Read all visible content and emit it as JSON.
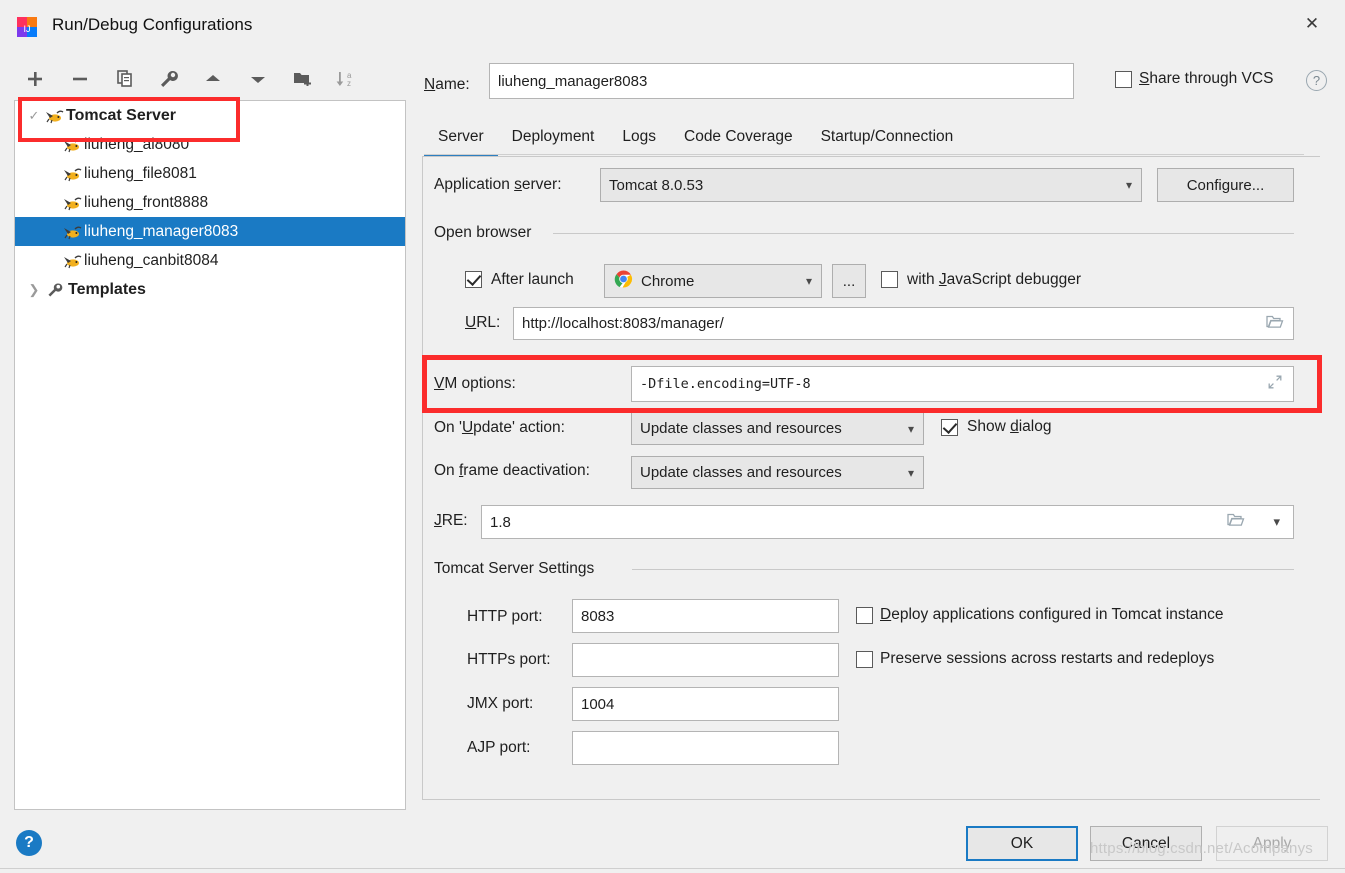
{
  "window": {
    "title": "Run/Debug Configurations",
    "app_icon": "intellij-idea-icon",
    "close_icon": "close-icon"
  },
  "toolbar": {
    "buttons": [
      {
        "name": "add-configuration",
        "icon": "plus-icon",
        "label": "+"
      },
      {
        "name": "remove-configuration",
        "icon": "minus-icon",
        "label": "−"
      },
      {
        "name": "copy-configuration",
        "icon": "copy-icon",
        "label": "copy"
      },
      {
        "name": "edit-templates",
        "icon": "wrench-icon",
        "label": "wrench"
      },
      {
        "name": "move-up",
        "icon": "arrow-up-icon",
        "label": "▲"
      },
      {
        "name": "move-down",
        "icon": "arrow-down-icon",
        "label": "▼"
      },
      {
        "name": "create-folder",
        "icon": "new-folder-icon",
        "label": "folder+"
      },
      {
        "name": "sort-alphabetically",
        "icon": "sort-az-icon",
        "label": "sort a-z"
      }
    ]
  },
  "tree": {
    "items": [
      {
        "label": "Tomcat Server",
        "level": 0,
        "bold": true,
        "selected": false,
        "twisty": "expanded",
        "icon": "tomcat-icon",
        "highlighted": true
      },
      {
        "label": "liuheng_ai8080",
        "level": 1,
        "bold": false,
        "selected": false,
        "twisty": "",
        "icon": "tomcat-icon",
        "highlighted": false
      },
      {
        "label": "liuheng_file8081",
        "level": 1,
        "bold": false,
        "selected": false,
        "twisty": "",
        "icon": "tomcat-icon",
        "highlighted": false
      },
      {
        "label": "liuheng_front8888",
        "level": 1,
        "bold": false,
        "selected": false,
        "twisty": "",
        "icon": "tomcat-icon",
        "highlighted": false
      },
      {
        "label": "liuheng_manager8083",
        "level": 1,
        "bold": false,
        "selected": true,
        "twisty": "",
        "icon": "tomcat-icon",
        "highlighted": false
      },
      {
        "label": "liuheng_canbit8084",
        "level": 1,
        "bold": false,
        "selected": false,
        "twisty": "",
        "icon": "tomcat-icon",
        "highlighted": false
      },
      {
        "label": "Templates",
        "level": 0,
        "bold": true,
        "selected": false,
        "twisty": "collapsed",
        "icon": "wrench-icon",
        "highlighted": false
      }
    ]
  },
  "header": {
    "name_label": "Name:",
    "name_value": "liuheng_manager8083",
    "share_label": "Share through VCS",
    "share_checked": false,
    "help_icon": "help-circle-icon"
  },
  "tabs": [
    {
      "label": "Server",
      "active": true
    },
    {
      "label": "Deployment",
      "active": false
    },
    {
      "label": "Logs",
      "active": false
    },
    {
      "label": "Code Coverage",
      "active": false
    },
    {
      "label": "Startup/Connection",
      "active": false
    }
  ],
  "server_tab": {
    "application_server_label": "Application server:",
    "application_server_value": "Tomcat 8.0.53",
    "configure_button": "Configure...",
    "open_browser_group": "Open browser",
    "after_launch_label": "After launch",
    "after_launch_checked": true,
    "browser_value": "Chrome",
    "browser_icon": "chrome-icon",
    "ellipsis_button": "...",
    "js_debugger_label": "with JavaScript debugger",
    "js_debugger_checked": false,
    "url_label": "URL:",
    "url_value": "http://localhost:8083/manager/",
    "url_browse_icon": "folder-open-icon",
    "vm_options_label": "VM options:",
    "vm_options_value": "-Dfile.encoding=UTF-8",
    "vm_options_expand_icon": "expand-arrows-icon",
    "vm_options_highlighted": true,
    "on_update_label": "On 'Update' action:",
    "on_update_value": "Update classes and resources",
    "show_dialog_label": "Show dialog",
    "show_dialog_checked": true,
    "on_frame_deactivation_label": "On frame deactivation:",
    "on_frame_deactivation_value": "Update classes and resources",
    "jre_label": "JRE:",
    "jre_value": "1.8",
    "jre_browse_icon": "folder-open-icon",
    "jre_caret_icon": "chevron-down-icon",
    "tomcat_settings_group": "Tomcat Server Settings",
    "ports": [
      {
        "label": "HTTP port:",
        "value": "8083",
        "name": "http-port"
      },
      {
        "label": "HTTPs port:",
        "value": "",
        "name": "https-port"
      },
      {
        "label": "JMX port:",
        "value": "1004",
        "name": "jmx-port"
      },
      {
        "label": "AJP port:",
        "value": "",
        "name": "ajp-port"
      }
    ],
    "deploy_apps_label": "Deploy applications configured in Tomcat instance",
    "deploy_apps_checked": false,
    "preserve_sessions_label": "Preserve sessions across restarts and redeploys",
    "preserve_sessions_checked": false
  },
  "footer": {
    "help_label": "?",
    "ok_label": "OK",
    "cancel_label": "Cancel",
    "apply_label": "Apply",
    "watermark": "https://blog.csdn.net/Acompanys"
  },
  "colors": {
    "accent": "#1a7ac4",
    "highlight_red": "#fb2c2c",
    "window_bg": "#f0f0f0",
    "field_bg": "#ffffff",
    "selection_bg": "#1a7ac4"
  }
}
